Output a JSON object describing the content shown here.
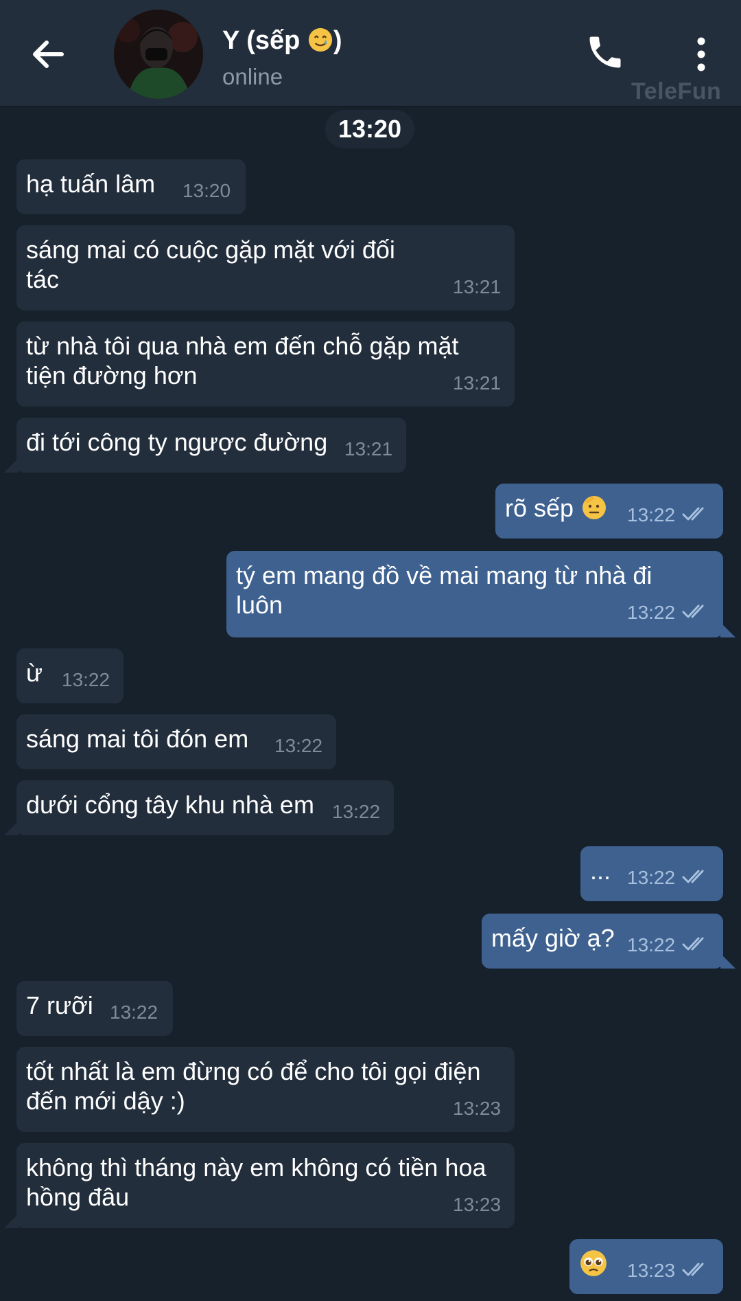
{
  "header": {
    "back_icon": "arrow-left-icon",
    "contact_name": "Y (sếp ",
    "contact_emoji": "smiling-face-with-tear-emoji",
    "contact_name_close": ")",
    "status": "online",
    "call_icon": "phone-icon",
    "menu_icon": "more-vertical-icon",
    "watermark": "TeleFun"
  },
  "date_chip": "13:20",
  "colors": {
    "background": "#17212b",
    "header": "#232e3c",
    "incoming_bubble": "#232e3c",
    "outgoing_bubble": "#3e6190",
    "read_ticks": "#a8c1de"
  },
  "messages": [
    {
      "dir": "in",
      "text": "hạ tuấn lâm",
      "time": "13:20"
    },
    {
      "dir": "in",
      "text": "sáng mai có cuộc gặp mặt với đối\ntác",
      "time": "13:21"
    },
    {
      "dir": "in",
      "text": "từ nhà tôi qua nhà em đến chỗ gặp mặt\ntiện đường hơn",
      "time": "13:21"
    },
    {
      "dir": "in",
      "text": "đi tới công ty ngược đường",
      "time": "13:21"
    },
    {
      "dir": "out",
      "text": "rõ sếp",
      "emoji": "saluting-face-emoji",
      "time": "13:22",
      "status": "read"
    },
    {
      "dir": "out",
      "text": "tý em mang đồ về mai mang từ nhà đi\nluôn",
      "time": "13:22",
      "status": "read"
    },
    {
      "dir": "in",
      "text": "ừ",
      "time": "13:22"
    },
    {
      "dir": "in",
      "text": "sáng mai tôi đón em",
      "time": "13:22"
    },
    {
      "dir": "in",
      "text": "dưới cổng tây khu nhà em",
      "time": "13:22"
    },
    {
      "dir": "out",
      "text": "...",
      "time": "13:22",
      "status": "read"
    },
    {
      "dir": "out",
      "text": "mấy giờ ạ?",
      "time": "13:22",
      "status": "read"
    },
    {
      "dir": "in",
      "text": "7 rưỡi",
      "time": "13:22"
    },
    {
      "dir": "in",
      "text": "tốt nhất là em đừng có để cho tôi gọi điện\nđến mới dậy :)",
      "time": "13:23"
    },
    {
      "dir": "in",
      "text": "không thì tháng này em không có tiền hoa\nhồng đâu",
      "time": "13:23"
    },
    {
      "dir": "out",
      "text": "",
      "emoji": "pleading-face-emoji",
      "time": "13:23",
      "status": "read"
    }
  ]
}
